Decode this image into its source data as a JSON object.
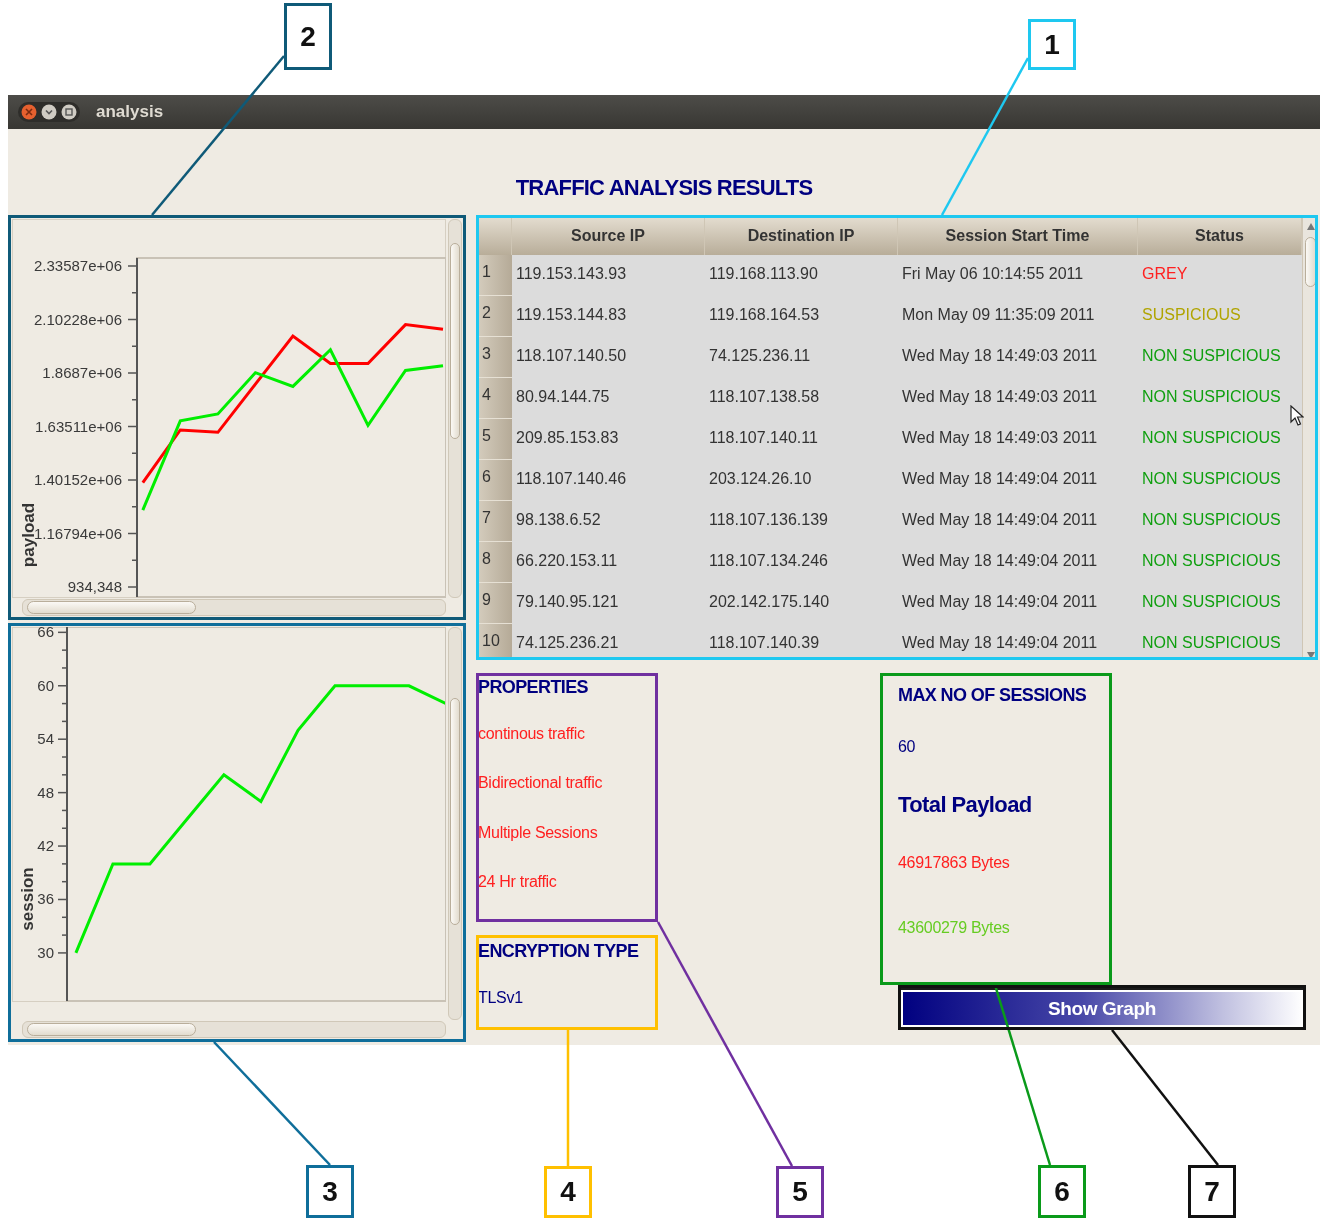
{
  "window": {
    "title": "analysis"
  },
  "heading": "TRAFFIC ANALYSIS RESULTS",
  "payload_chart": {
    "chart_data": {
      "type": "line",
      "ylabel": "payload",
      "categories": [
        null,
        null,
        null,
        null,
        null,
        null,
        null,
        null,
        null
      ],
      "ylim": [
        890709,
        2370799
      ],
      "yticks": [
        {
          "value": 934348,
          "label": "934,348"
        },
        {
          "value": 1167940,
          "label": "1.16794e+06"
        },
        {
          "value": 1401520,
          "label": "1.40152e+06"
        },
        {
          "value": 1635110,
          "label": "1.63511e+06"
        },
        {
          "value": 1868700,
          "label": "1.8687e+06"
        },
        {
          "value": 2102280,
          "label": "2.10228e+06"
        },
        {
          "value": 2335870,
          "label": "2.33587e+06"
        }
      ],
      "series": [
        {
          "color": "#ff0000",
          "values": [
            1390000,
            1620000,
            1610000,
            1820000,
            2030000,
            1910000,
            1910000,
            2080000,
            2060000
          ]
        },
        {
          "color": "#00ee00",
          "values": [
            1270000,
            1660000,
            1690000,
            1870000,
            1810000,
            1970000,
            1640000,
            1880000,
            1900000
          ]
        }
      ]
    }
  },
  "session_chart": {
    "chart_data": {
      "type": "line",
      "ylabel": "session",
      "categories": [
        null,
        null,
        null,
        null,
        null,
        null,
        null,
        null,
        null,
        null,
        null
      ],
      "ylim": [
        24.6,
        66.6
      ],
      "yticks": [
        {
          "value": 30,
          "label": "30"
        },
        {
          "value": 36,
          "label": "36"
        },
        {
          "value": 42,
          "label": "42"
        },
        {
          "value": 48,
          "label": "48"
        },
        {
          "value": 54,
          "label": "54"
        },
        {
          "value": 60,
          "label": "60"
        },
        {
          "value": 66,
          "label": "66"
        }
      ],
      "series": [
        {
          "color": "#00ee00",
          "values": [
            30,
            40,
            40,
            45,
            50,
            47,
            55,
            60,
            60,
            60,
            58
          ]
        }
      ]
    }
  },
  "table": {
    "columns": [
      "Source IP",
      "Destination IP",
      "Session Start Time",
      "Status"
    ],
    "rows": [
      {
        "number": "1",
        "source_ip": "119.153.143.93",
        "destination_ip": "119.168.113.90",
        "start_time": "Fri May 06 10:14:55 2011",
        "status": "GREY",
        "color": "#ff2020"
      },
      {
        "number": "2",
        "source_ip": "119.153.144.83",
        "destination_ip": "119.168.164.53",
        "start_time": "Mon May 09 11:35:09 2011",
        "status": "SUSPICIOUS",
        "color": "#b0a400"
      },
      {
        "number": "3",
        "source_ip": "118.107.140.50",
        "destination_ip": "74.125.236.11",
        "start_time": "Wed May 18 14:49:03 2011",
        "status": "NON SUSPICIOUS",
        "color": "#0f9f0f"
      },
      {
        "number": "4",
        "source_ip": "80.94.144.75",
        "destination_ip": "118.107.138.58",
        "start_time": "Wed May 18 14:49:03 2011",
        "status": "NON SUSPICIOUS",
        "color": "#0f9f0f"
      },
      {
        "number": "5",
        "source_ip": "209.85.153.83",
        "destination_ip": "118.107.140.11",
        "start_time": "Wed May 18 14:49:03 2011",
        "status": "NON SUSPICIOUS",
        "color": "#0f9f0f"
      },
      {
        "number": "6",
        "source_ip": "118.107.140.46",
        "destination_ip": "203.124.26.10",
        "start_time": "Wed May 18 14:49:04 2011",
        "status": "NON SUSPICIOUS",
        "color": "#0f9f0f"
      },
      {
        "number": "7",
        "source_ip": "98.138.6.52",
        "destination_ip": "118.107.136.139",
        "start_time": "Wed May 18 14:49:04 2011",
        "status": "NON SUSPICIOUS",
        "color": "#0f9f0f"
      },
      {
        "number": "8",
        "source_ip": "66.220.153.11",
        "destination_ip": "118.107.134.246",
        "start_time": "Wed May 18 14:49:04 2011",
        "status": "NON SUSPICIOUS",
        "color": "#0f9f0f"
      },
      {
        "number": "9",
        "source_ip": "79.140.95.121",
        "destination_ip": "202.142.175.140",
        "start_time": "Wed May 18 14:49:04 2011",
        "status": "NON SUSPICIOUS",
        "color": "#0f9f0f"
      },
      {
        "number": "10",
        "source_ip": "74.125.236.21",
        "destination_ip": "118.107.140.39",
        "start_time": "Wed May 18 14:49:04 2011",
        "status": "NON SUSPICIOUS",
        "color": "#0f9f0f"
      }
    ]
  },
  "properties": {
    "title": "PROPERTIES",
    "items": [
      "continous traffic",
      "Bidirectional traffic",
      "Multiple Sessions",
      "24 Hr traffic"
    ]
  },
  "encryption": {
    "title": "ENCRYPTION TYPE",
    "value": "TLSv1"
  },
  "sessions": {
    "title": "MAX NO OF SESSIONS",
    "value": "60",
    "payload_title": "Total Payload",
    "payloads": [
      {
        "text": "46917863 Bytes",
        "color": "#ff2020"
      },
      {
        "text": "43600279 Bytes",
        "color": "#66cc22"
      }
    ]
  },
  "show_graph_button": {
    "label": "Show Graph"
  },
  "callouts": [
    {
      "number": "2",
      "color": "#0f5a78"
    },
    {
      "number": "1",
      "color": "#1ec8f0"
    },
    {
      "number": "3",
      "color": "#0f6e9a"
    },
    {
      "number": "4",
      "color": "#ffc000"
    },
    {
      "number": "5",
      "color": "#7030a0"
    },
    {
      "number": "6",
      "color": "#0a9a1a"
    },
    {
      "number": "7",
      "color": "#111111"
    }
  ]
}
